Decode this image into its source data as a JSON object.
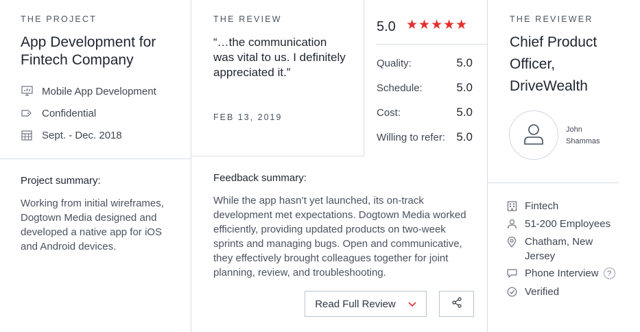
{
  "project": {
    "eyebrow": "THE PROJECT",
    "title": "App Development for Fintech Company",
    "meta": [
      {
        "icon": "monitor-chart-icon",
        "text": "Mobile App Development"
      },
      {
        "icon": "tag-icon",
        "text": "Confidential"
      },
      {
        "icon": "calendar-icon",
        "text": "Sept. - Dec. 2018"
      }
    ],
    "summary_label": "Project summary:",
    "summary_text": "Working from initial wireframes, Dogtown Media designed and developed a native app for iOS and Android devices."
  },
  "review": {
    "eyebrow": "THE REVIEW",
    "quote": "“…the communication was vital to us. I definitely appreciated it.”",
    "date": "FEB 13, 2019",
    "overall": "5.0",
    "stars": "★★★★★",
    "ratings": [
      {
        "label": "Quality:",
        "value": "5.0"
      },
      {
        "label": "Schedule:",
        "value": "5.0"
      },
      {
        "label": "Cost:",
        "value": "5.0"
      },
      {
        "label": "Willing to refer:",
        "value": "5.0"
      }
    ],
    "feedback_label": "Feedback summary:",
    "feedback_text": "While the app hasn’t yet launched, its on-track development met expectations. Dogtown Media worked efficiently, providing updated products on two-week sprints and managing bugs. Open and communicative, they effectively brought colleagues together for joint planning, review, and troubleshooting.",
    "read_full_label": "Read Full Review"
  },
  "reviewer": {
    "eyebrow": "THE REVIEWER",
    "title": "Chief Product Officer, DriveWealth",
    "name_line1": "John",
    "name_line2": "Shammas",
    "details": [
      {
        "icon": "building-icon",
        "text": "Fintech"
      },
      {
        "icon": "person-icon",
        "text": "51-200 Employees"
      },
      {
        "icon": "location-pin-icon",
        "text": "Chatham, New Jersey"
      },
      {
        "icon": "speech-bubble-icon",
        "text": "Phone Interview",
        "help": "?"
      },
      {
        "icon": "check-circle-icon",
        "text": "Verified"
      }
    ]
  },
  "colors": {
    "accent": "#e62e2d",
    "border": "#d8dde3",
    "text": "#2f3542"
  }
}
